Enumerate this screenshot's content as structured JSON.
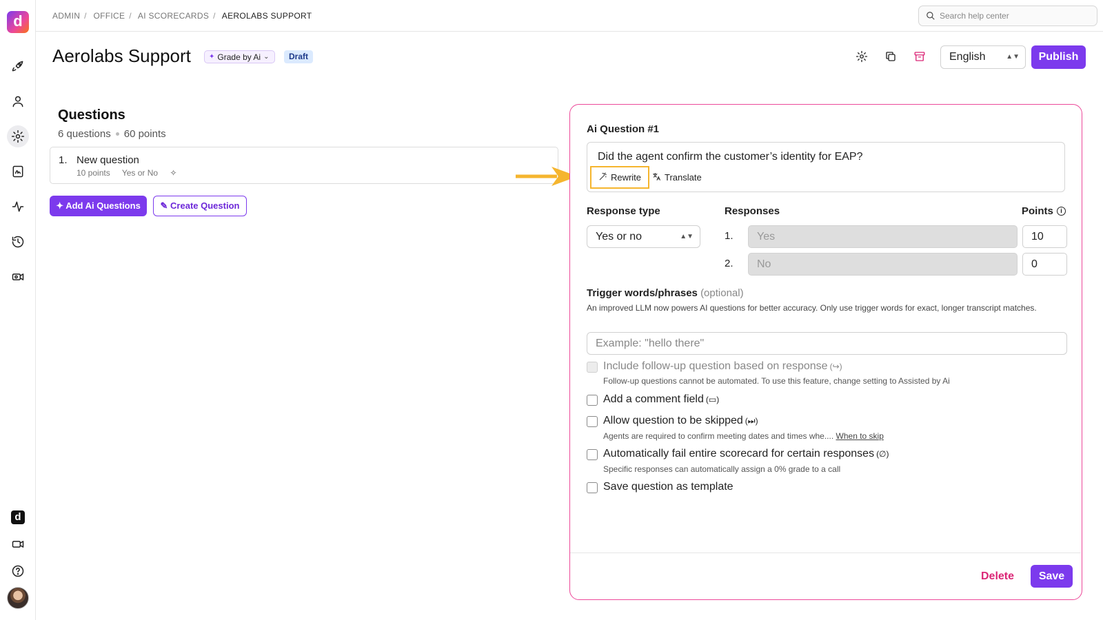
{
  "breadcrumb": [
    "ADMIN",
    "OFFICE",
    "AI SCORECARDS",
    "AEROLABS SUPPORT"
  ],
  "search": {
    "placeholder": "Search help center"
  },
  "header": {
    "title": "Aerolabs Support",
    "grade_label": "Grade by Ai",
    "status_badge": "Draft",
    "language": "English",
    "publish_label": "Publish"
  },
  "questions": {
    "heading": "Questions",
    "count_text": "6 questions",
    "points_text": "60 points",
    "items": [
      {
        "number": "1.",
        "title": "New question",
        "points": "10 points",
        "type": "Yes or No"
      }
    ],
    "add_ai_label": "Add Ai Questions",
    "create_label": "Create Question"
  },
  "editor": {
    "title": "Ai Question #1",
    "question_text": "Did the agent confirm the customer’s identity for EAP?",
    "rewrite_label": "Rewrite",
    "translate_label": "Translate",
    "response_type_label": "Response type",
    "response_type_value": "Yes or no",
    "responses_label": "Responses",
    "points_label": "Points",
    "responses": [
      {
        "number": "1.",
        "value": "Yes",
        "points": "10"
      },
      {
        "number": "2.",
        "value": "No",
        "points": "0"
      }
    ],
    "trigger_label": "Trigger words/phrases",
    "trigger_optional": "(optional)",
    "trigger_help": "An improved LLM now powers AI questions for better accuracy. Only use trigger words for exact, longer transcript matches.",
    "trigger_placeholder": "Example: \"hello there\"",
    "options": [
      {
        "label": "Include follow-up question based on response",
        "symbol": "(↪)",
        "help": "Follow-up questions cannot be automated. To use this feature, change setting to Assisted by Ai",
        "disabled": true
      },
      {
        "label": "Add a comment field",
        "symbol": "(▭)",
        "help": ""
      },
      {
        "label": "Allow question to be skipped",
        "symbol": "(⏭)",
        "help": "Agents are required to confirm meeting dates and times whe....",
        "link": "When to skip"
      },
      {
        "label": "Automatically fail entire scorecard for certain responses",
        "symbol": "(∅)",
        "help": "Specific responses can automatically assign a 0% grade to a call"
      },
      {
        "label": "Save question as template",
        "symbol": "",
        "help": ""
      }
    ],
    "delete_label": "Delete",
    "save_label": "Save"
  },
  "colors": {
    "accent": "#7c3aed",
    "danger": "#db2777",
    "highlight": "#f5b52e"
  },
  "icons": [
    "rocket-icon",
    "user-icon",
    "gear-icon",
    "signature-icon",
    "activity-icon",
    "history-icon",
    "camera-icon",
    "video-icon",
    "help-icon",
    "search-icon",
    "settings-icon",
    "copy-icon",
    "archive-icon",
    "sparkle-icon",
    "edit-icon",
    "wand-icon",
    "translate-icon",
    "info-icon"
  ]
}
